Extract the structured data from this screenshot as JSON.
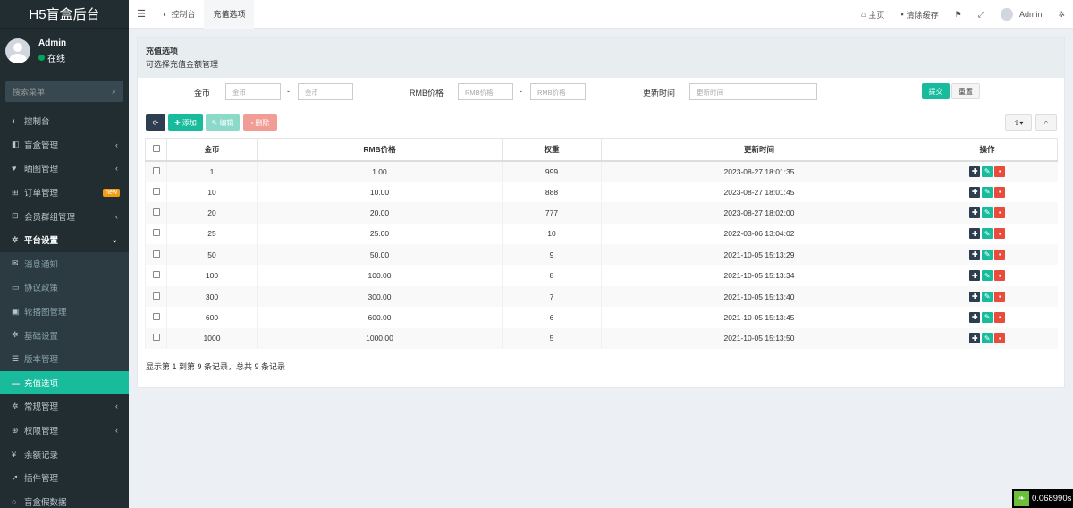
{
  "brand": "H5盲盒后台",
  "user": {
    "name": "Admin",
    "status": "在线"
  },
  "search": {
    "placeholder": "搜索菜单"
  },
  "menu": [
    {
      "label": "控制台",
      "icon": "dashboard-icon",
      "glyph": "◐"
    },
    {
      "label": "盲盒管理",
      "icon": "cube-icon",
      "glyph": "◧",
      "arrow": "‹"
    },
    {
      "label": "晒图管理",
      "icon": "heart-icon",
      "glyph": "♥",
      "arrow": "‹"
    },
    {
      "label": "订单管理",
      "icon": "cart-icon",
      "glyph": "⊞",
      "badge": "new"
    },
    {
      "label": "会员群组管理",
      "icon": "users-icon",
      "glyph": "⊡",
      "arrow": "‹"
    },
    {
      "label": "平台设置",
      "icon": "gear-icon",
      "glyph": "✲",
      "arrow": "⌄"
    },
    {
      "label": "消息通知",
      "icon": "envelope-icon",
      "glyph": "✉"
    },
    {
      "label": "协议政策",
      "icon": "book-icon",
      "glyph": "▭"
    },
    {
      "label": "轮播图管理",
      "icon": "image-icon",
      "glyph": "▣"
    },
    {
      "label": "基础设置",
      "icon": "cog-icon",
      "glyph": "✲"
    },
    {
      "label": "版本管理",
      "icon": "list-icon",
      "glyph": "☰"
    },
    {
      "label": "充值选项",
      "icon": "card-icon",
      "glyph": "▬"
    },
    {
      "label": "常规管理",
      "icon": "cogs-icon",
      "glyph": "✲",
      "arrow": "‹"
    },
    {
      "label": "权限管理",
      "icon": "group-icon",
      "glyph": "⊕",
      "arrow": "‹"
    },
    {
      "label": "余额记录",
      "icon": "yen-icon",
      "glyph": "¥"
    },
    {
      "label": "插件管理",
      "icon": "rocket-icon",
      "glyph": "➚"
    },
    {
      "label": "盲盒假数据",
      "icon": "circle-icon",
      "glyph": "○"
    }
  ],
  "topbar": {
    "tabs": [
      "控制台",
      "充值选项"
    ],
    "home": "主页",
    "clear_cache": "清除缓存",
    "admin": "Admin"
  },
  "panel": {
    "title": "充值选项",
    "subtitle": "可选择充值金额管理"
  },
  "filters": {
    "coin_label": "金币",
    "coin_from_ph": "金币",
    "coin_to_ph": "金币",
    "rmb_label": "RMB价格",
    "rmb_from_ph": "RMB价格",
    "rmb_to_ph": "RMB价格",
    "time_label": "更新时间",
    "time_ph": "更新时间",
    "dash": "-",
    "submit": "提交",
    "reset": "重置"
  },
  "toolbar": {
    "add": "添加",
    "edit": "编辑",
    "delete": "删除"
  },
  "table": {
    "headers": [
      "金币",
      "RMB价格",
      "权重",
      "更新时间",
      "操作"
    ],
    "rows": [
      [
        "1",
        "1.00",
        "999",
        "2023-08-27 18:01:35"
      ],
      [
        "10",
        "10.00",
        "888",
        "2023-08-27 18:01:45"
      ],
      [
        "20",
        "20.00",
        "777",
        "2023-08-27 18:02:00"
      ],
      [
        "25",
        "25.00",
        "10",
        "2022-03-06 13:04:02"
      ],
      [
        "50",
        "50.00",
        "9",
        "2021-10-05 15:13:29"
      ],
      [
        "100",
        "100.00",
        "8",
        "2021-10-05 15:13:34"
      ],
      [
        "300",
        "300.00",
        "7",
        "2021-10-05 15:13:40"
      ],
      [
        "600",
        "600.00",
        "6",
        "2021-10-05 15:13:45"
      ],
      [
        "1000",
        "1000.00",
        "5",
        "2021-10-05 15:13:50"
      ]
    ]
  },
  "summary": "显示第 1 到第 9 条记录，总共 9 条记录",
  "timing": "0.068990s"
}
